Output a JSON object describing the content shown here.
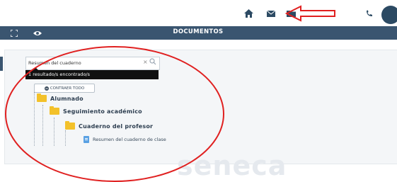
{
  "topbar": {
    "icons": [
      "home-icon",
      "envelope-icon",
      "folder-icon",
      "phone-icon"
    ],
    "avatar_letter": "",
    "annotation_color": "#e02020"
  },
  "header": {
    "title": "DOCUMENTOS",
    "icons": [
      "expand-icon",
      "eye-icon"
    ],
    "bg_color": "#3a5570"
  },
  "search": {
    "value": "Resumen del cuaderno",
    "clear_symbol": "×",
    "results_text": "1 resultado/s encontrado/s"
  },
  "tree": {
    "collapse_label": "CONTRAER TODO",
    "nodes": [
      {
        "label": "Alumnado",
        "type": "folder"
      },
      {
        "label": "Seguimiento académico",
        "type": "folder"
      },
      {
        "label": "Cuaderno del profesor",
        "type": "folder"
      },
      {
        "label": "Resumen del cuaderno de clase",
        "type": "document"
      }
    ]
  },
  "watermark": "seneca"
}
